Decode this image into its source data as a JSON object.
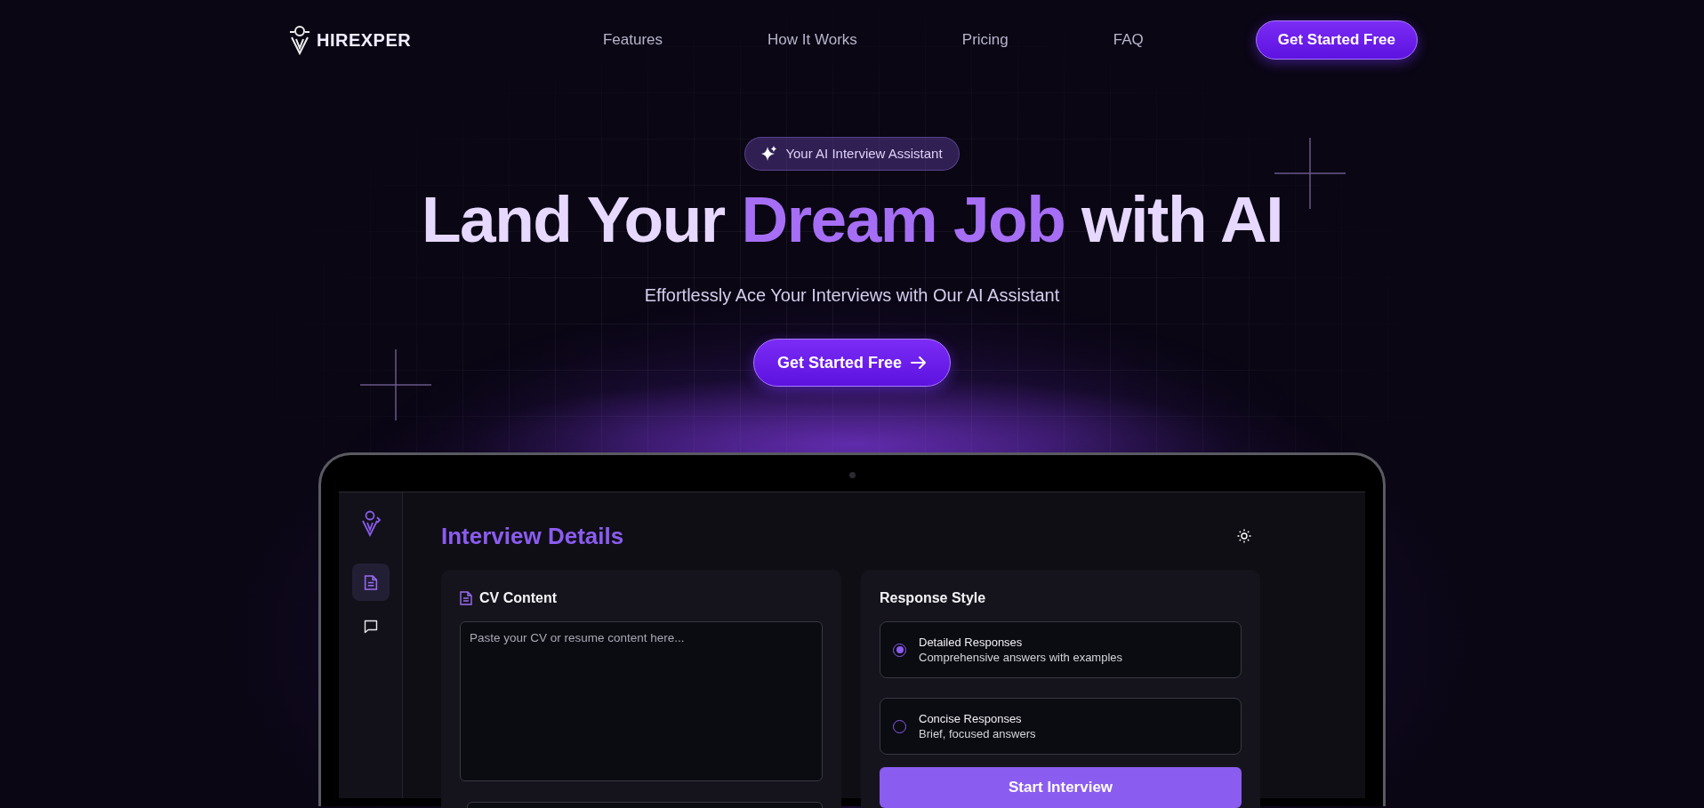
{
  "nav": {
    "logo": "HIREXPER",
    "links": [
      "Features",
      "How It Works",
      "Pricing",
      "FAQ"
    ],
    "cta": "Get Started Free"
  },
  "hero": {
    "badge": "Your AI Interview Assistant",
    "headline": [
      {
        "text": "Land Your ",
        "highlight": false
      },
      {
        "text": "Dream Job",
        "highlight": true
      },
      {
        "text": " with AI",
        "highlight": false
      }
    ],
    "subtitle": "Effortlessly Ace Your Interviews with Our AI Assistant",
    "cta": "Get Started Free"
  },
  "app": {
    "sidebar": {
      "items": [
        {
          "kind": "document",
          "selected": true
        },
        {
          "kind": "chat",
          "selected": false
        }
      ]
    },
    "title": "Interview Details",
    "cv_card": {
      "title": "CV Content",
      "placeholder": "Paste your CV or resume content here..."
    },
    "response_style": {
      "title": "Response Style",
      "options": [
        {
          "label": "Detailed Responses",
          "description": "Comprehensive answers with examples",
          "selected": true
        },
        {
          "label": "Concise Responses",
          "description": "Brief, focused answers",
          "selected": false
        }
      ]
    },
    "start_button": "Start Interview"
  }
}
